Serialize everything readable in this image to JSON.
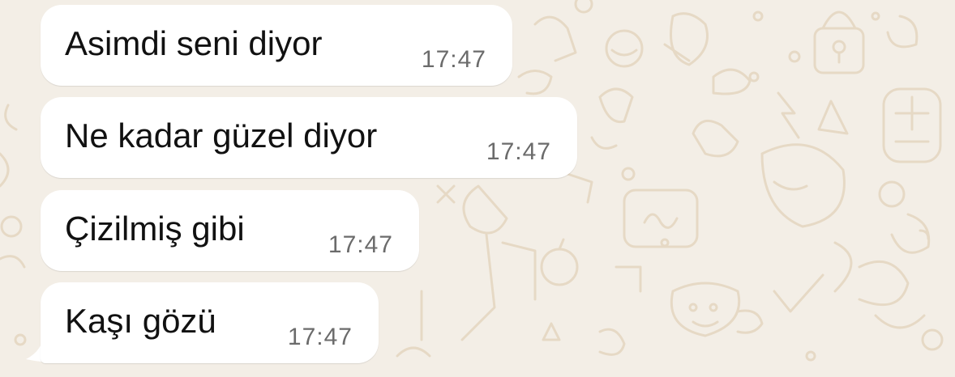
{
  "messages": [
    {
      "text": "Asimdi seni diyor",
      "time": "17:47"
    },
    {
      "text": "Ne kadar güzel diyor",
      "time": "17:47"
    },
    {
      "text": "Çizilmiş gibi",
      "time": "17:47"
    },
    {
      "text": "Kaşı gözü",
      "time": "17:47"
    }
  ],
  "colors": {
    "background": "#f3eee6",
    "bubble": "#ffffff",
    "text": "#111111",
    "time": "#6b6b6b",
    "doodle": "#e6d9c5"
  }
}
